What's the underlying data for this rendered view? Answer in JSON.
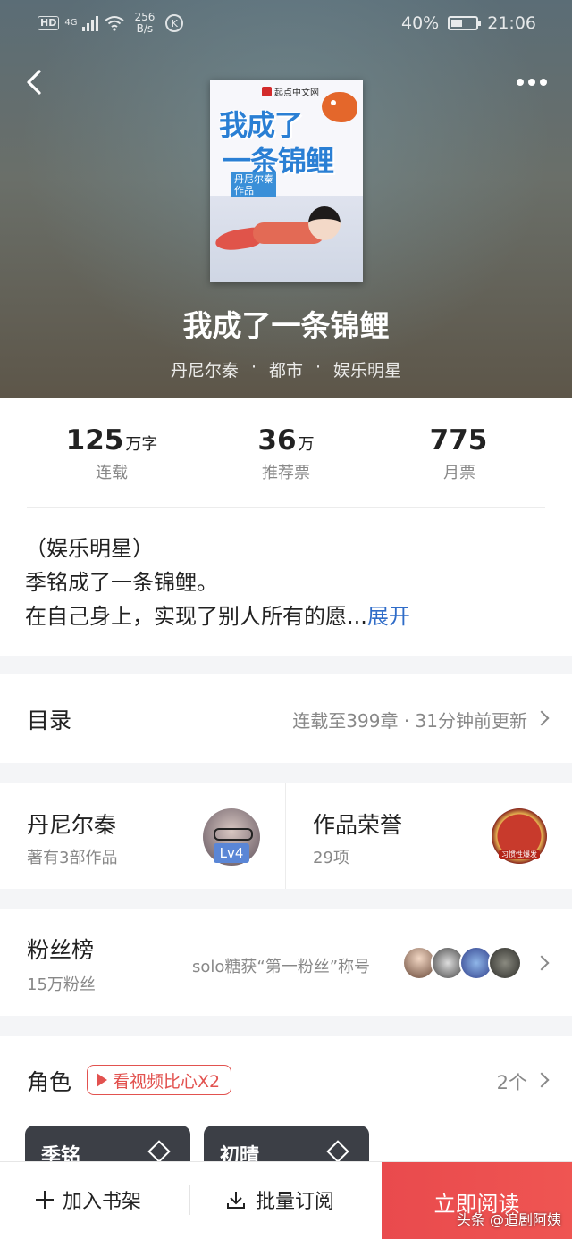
{
  "status_bar": {
    "hd": "HD",
    "network": "4G",
    "speed": "256",
    "speed_unit": "B/s",
    "k_icon": "K",
    "battery": "40%",
    "time": "21:06"
  },
  "book": {
    "title": "我成了一条锦鲤",
    "author": "丹尼尔秦",
    "genre": "都市",
    "tag": "娱乐明星",
    "separator": "·",
    "cover": {
      "publisher": "起点中文网",
      "title_line1": "我成了",
      "title_line2": "一条锦鲤",
      "author_badge_line1": "丹尼尔秦",
      "author_badge_line2": "作品"
    }
  },
  "stats": [
    {
      "num": "125",
      "unit": "万字",
      "label": "连载"
    },
    {
      "num": "36",
      "unit": "万",
      "label": "推荐票"
    },
    {
      "num": "775",
      "unit": "",
      "label": "月票"
    }
  ],
  "intro": {
    "line1": "（娱乐明星）",
    "line2": "季铭成了一条锦鲤。",
    "line3": "在自己身上，实现了别人所有的愿...",
    "expand": "展开"
  },
  "toc": {
    "title": "目录",
    "status": "连载至399章 · 31分钟前更新"
  },
  "author_card": {
    "name": "丹尼尔秦",
    "works": "著有3部作品",
    "level": "Lv4"
  },
  "honor_card": {
    "title": "作品荣誉",
    "count": "29项",
    "badge": "习惯性爆发"
  },
  "fans": {
    "title": "粉丝榜",
    "count": "15万粉丝",
    "top_fan": "solo糖获“第一粉丝”称号"
  },
  "roles": {
    "title": "角色",
    "video_tag": "看视频比心X2",
    "count": "2个",
    "cards": [
      "季铭",
      "初晴"
    ]
  },
  "bottom": {
    "add_shelf": "加入书架",
    "bulk_buy": "批量订阅",
    "read_now": "立即阅读",
    "watermark": "头条 @追剧阿姨"
  },
  "colors": {
    "accent_red": "#e94a4d",
    "link_blue": "#2f6cc8",
    "level_blue": "#5a86d6"
  }
}
